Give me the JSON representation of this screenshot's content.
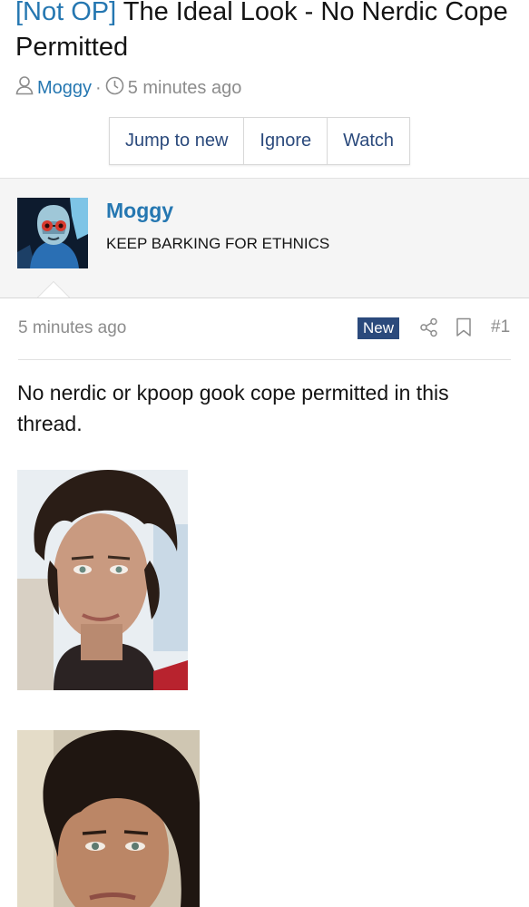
{
  "thread": {
    "prefix": "[Not OP]",
    "title": "The Ideal Look - No Nerdic Cope Permitted",
    "author": "Moggy",
    "separator": "·",
    "time": "5 minutes ago"
  },
  "actions": {
    "jump_to_new": "Jump to new",
    "ignore": "Ignore",
    "watch": "Watch"
  },
  "post": {
    "username": "Moggy",
    "user_title": "KEEP BARKING FOR ETHNICS",
    "time": "5 minutes ago",
    "badge": "New",
    "number": "#1",
    "body": "No nerdic or kpoop gook cope permitted in this thread."
  },
  "icons": {
    "user": "user-icon",
    "clock": "clock-icon",
    "share": "share-icon",
    "bookmark": "bookmark-icon"
  },
  "colors": {
    "link": "#2577b1",
    "accent": "#2b4a7c",
    "muted": "#8c8c8c"
  }
}
